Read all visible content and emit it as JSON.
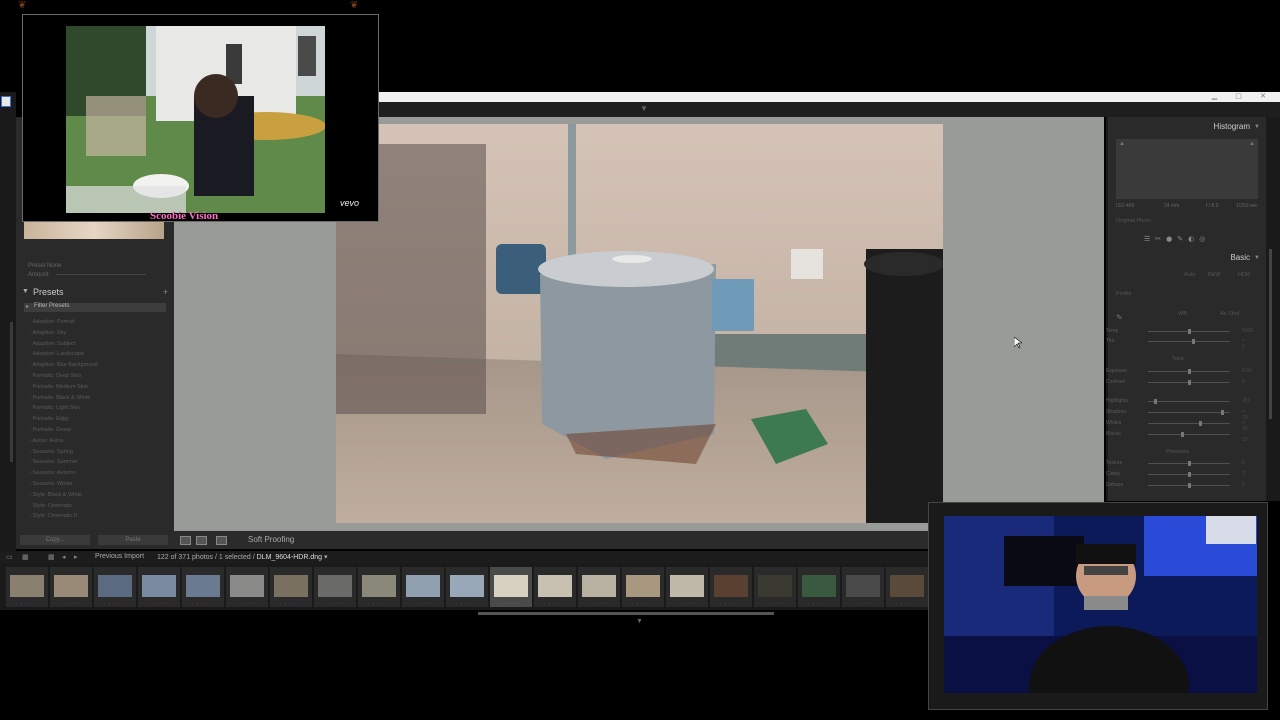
{
  "video_overlay": {
    "caption": "Scoobie Vision",
    "watermark": "vevo"
  },
  "left_panel": {
    "presets_title": "Presets",
    "filter_label": "Filter Presets",
    "preset_items": [
      "Adaptive: Portrait",
      "Adaptive: Sky",
      "Adaptive: Subject",
      "Adaptive: Landscape",
      "Adaptive: Blur Background",
      "Portraits: Deep Skin",
      "Portraits: Medium Skin",
      "Portraits: Black & White",
      "Portraits: Light Skin",
      "Portraits: Edgy",
      "Portraits: Group",
      "Autos: Autos",
      "Seasons: Spring",
      "Seasons: Summer",
      "Seasons: Autumn",
      "Seasons: Winter",
      "Style: Black & White",
      "Style: Cinematic",
      "Style: Cinematic II"
    ],
    "mini_rows": [
      "Preset    None",
      "Amount"
    ],
    "copy_label": "Copy...",
    "paste_label": "Paste"
  },
  "toolbar": {
    "soft_proofing_label": "Soft Proofing"
  },
  "right_panel": {
    "histogram_title": "Histogram",
    "histo_info": [
      "ISO 400",
      "24 mm",
      "f / 8.0",
      "1/250 sec"
    ],
    "original_photo_label": "Original Photo",
    "basic_title": "Basic",
    "treatment_options": [
      "Auto",
      "B&W",
      "HDR"
    ],
    "profile_label": "Profile",
    "wb_label": "WB",
    "wb_value": "As Shot",
    "tone_label": "Tone",
    "presence_label": "Presence",
    "sliders": [
      {
        "label": "Temp",
        "value": "5000",
        "pos": 0.5
      },
      {
        "label": "Tint",
        "value": "+ 2",
        "pos": 0.55
      },
      {
        "label": "Exposure",
        "value": "0.00",
        "pos": 0.5
      },
      {
        "label": "Contrast",
        "value": "0",
        "pos": 0.5
      },
      {
        "label": "Highlights",
        "value": "-83",
        "pos": 0.08
      },
      {
        "label": "Shadows",
        "value": "+ 79",
        "pos": 0.9
      },
      {
        "label": "Whites",
        "value": "+ 26",
        "pos": 0.63
      },
      {
        "label": "Blacks",
        "value": "- 15",
        "pos": 0.42
      },
      {
        "label": "Texture",
        "value": "0",
        "pos": 0.5
      },
      {
        "label": "Clarity",
        "value": "0",
        "pos": 0.5
      },
      {
        "label": "Dehaze",
        "value": "0",
        "pos": 0.5
      }
    ]
  },
  "filmstrip": {
    "source_label": "Previous Import",
    "count_text": "122 of 371 photos / 1 selected /",
    "filename": "DLM_9604-HDR.dng",
    "selected_index": 11
  }
}
